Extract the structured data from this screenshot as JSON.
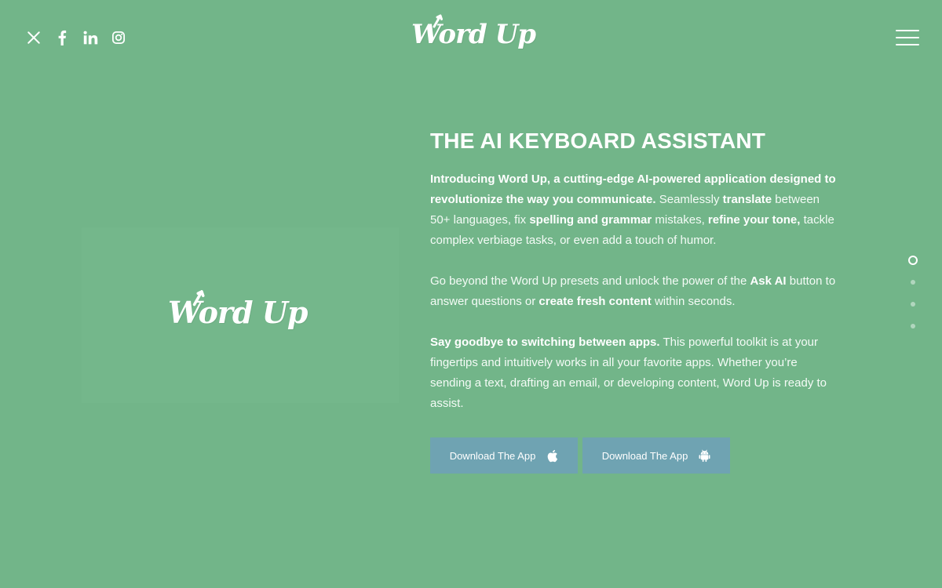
{
  "header": {
    "logo_text": "Word Up",
    "social": [
      {
        "name": "x-icon"
      },
      {
        "name": "facebook-icon"
      },
      {
        "name": "linkedin-icon"
      },
      {
        "name": "instagram-icon"
      }
    ]
  },
  "hero": {
    "logo_text": "Word Up"
  },
  "content": {
    "headline": "THE AI KEYBOARD ASSISTANT",
    "p1": {
      "s1": "Introducing Word Up, a cutting-edge AI-powered application designed to revolutionize the way you communicate.",
      "s2": " Seamlessly ",
      "s3": "translate",
      "s4": " between 50+ languages, fix ",
      "s5": "spelling and grammar",
      "s6": " mistakes, ",
      "s7": "refine your tone,",
      "s8": " tackle complex verbiage tasks, or even add a touch of humor."
    },
    "p2": {
      "s1": "Go beyond the Word Up presets and unlock the power of the ",
      "s2": "Ask AI",
      "s3": " button to answer questions or ",
      "s4": "create fresh content",
      "s5": " within seconds."
    },
    "p3": {
      "s1": "Say goodbye to switching between apps.",
      "s2": " This powerful toolkit is at your fingertips and intuitively works in all your favorite apps. Whether you’re sending a text, drafting an email, or developing content, Word Up is ready to assist."
    }
  },
  "buttons": {
    "ios_label": "Download The App",
    "android_label": "Download The App"
  },
  "pagination": {
    "total": 4,
    "active": 1
  },
  "colors": {
    "background": "#72b589",
    "button": "#6fa3b2",
    "text": "#ffffff"
  }
}
